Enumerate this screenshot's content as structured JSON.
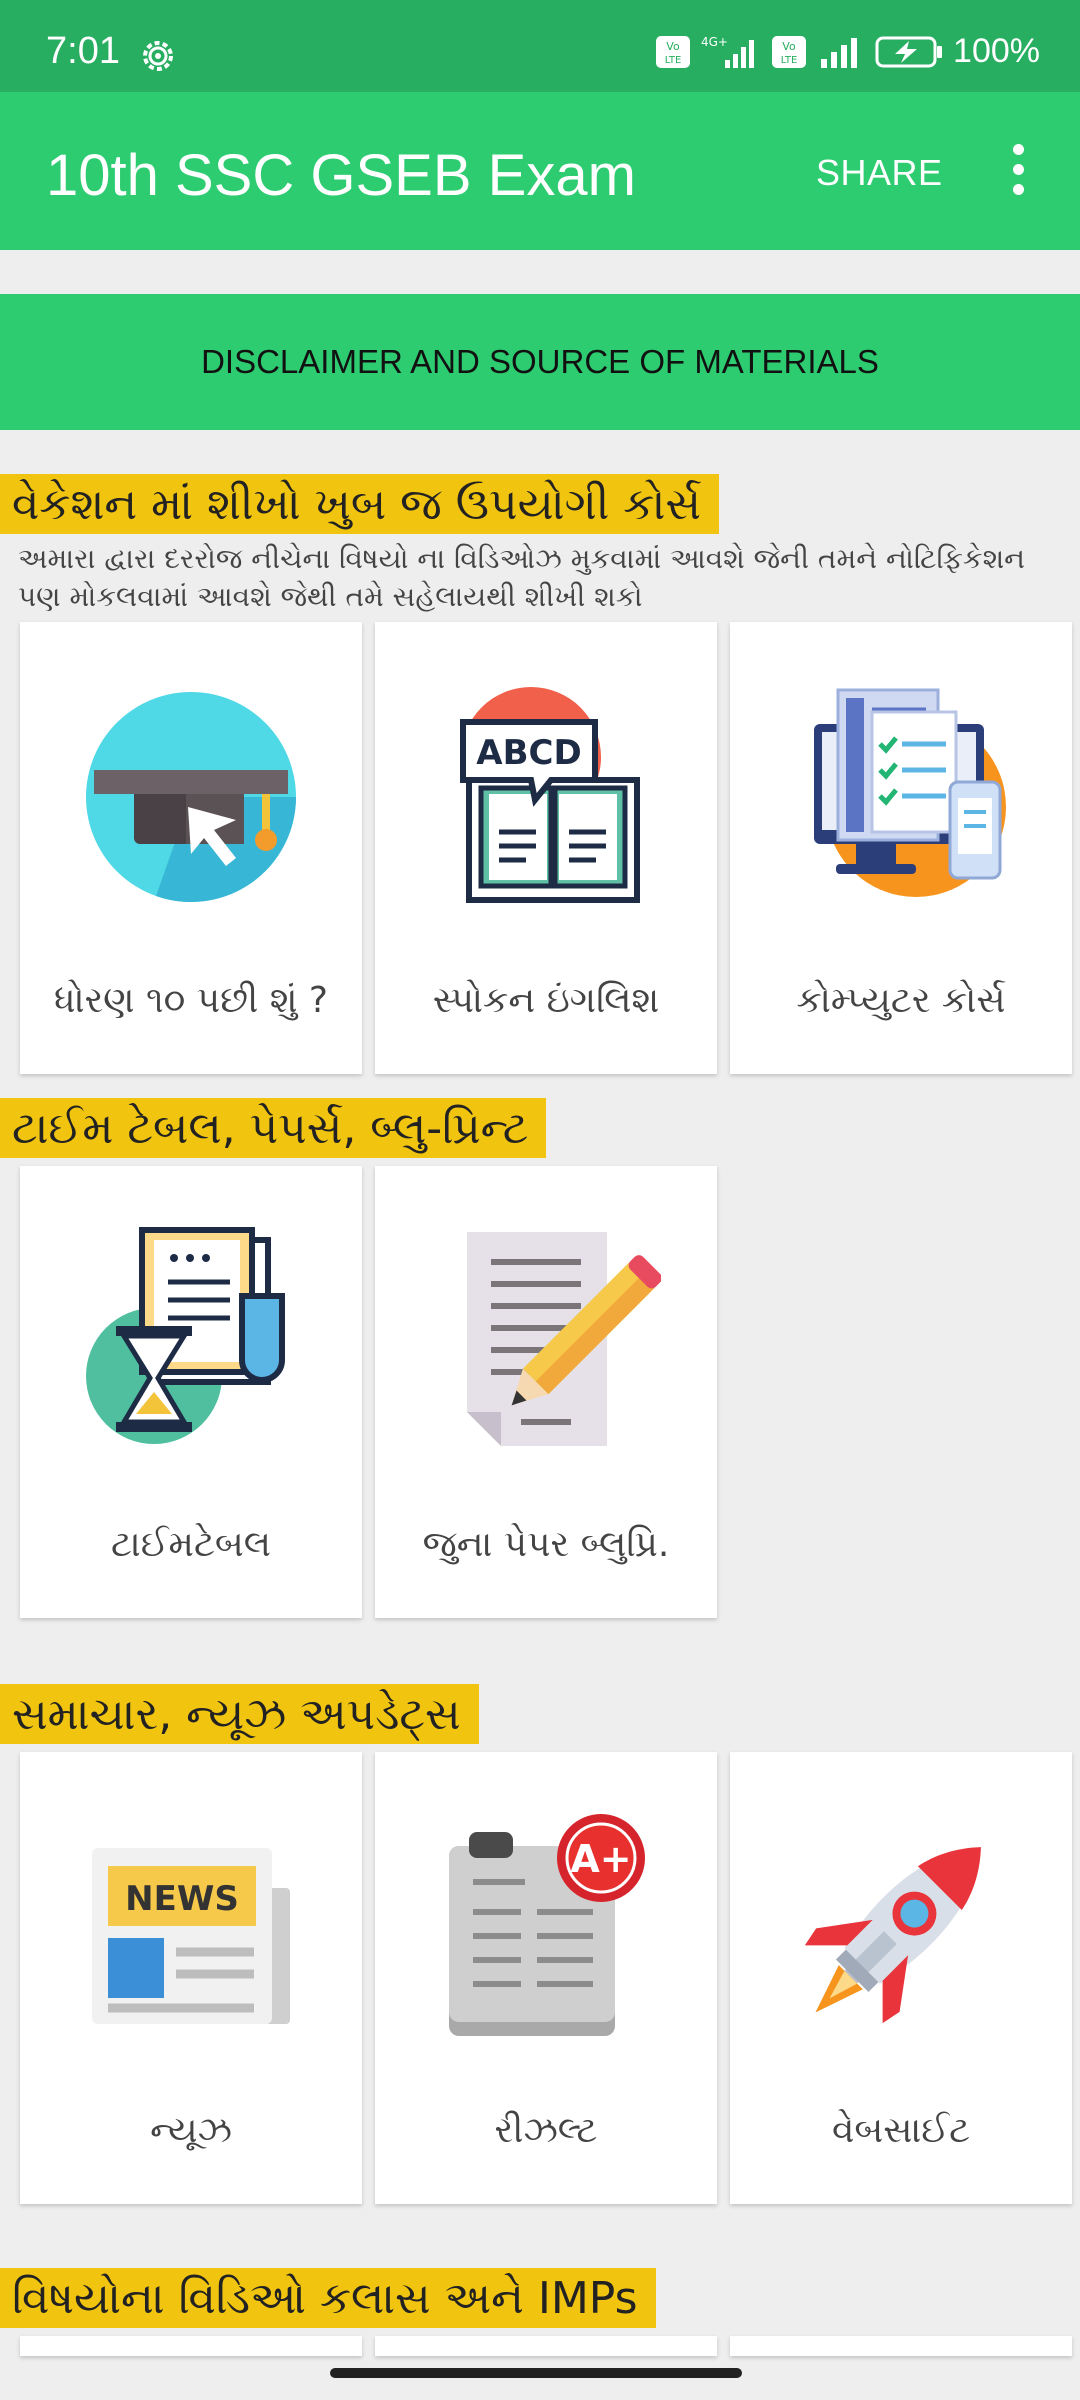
{
  "status_bar": {
    "time": "7:01",
    "battery_percent": "100%",
    "network_label": "4G+",
    "volte_label": "Vo LTE"
  },
  "app_bar": {
    "title": "10th SSC GSEB Exam",
    "share_label": "SHARE"
  },
  "disclaimer": {
    "label": "DISCLAIMER AND SOURCE OF MATERIALS"
  },
  "sections": [
    {
      "title": "વેકેશન માં શીખો ખુબ જ ઉપયોગી કોર્સ",
      "description": "અમારા દ્વારા દરરોજ નીચેના વિષયો ના વિડિઓઝ મુકવામાં આવશે જેની તમને નોટિફિકેશન પણ મોકલવામાં આવશે જેથી તમે સહેલાયથી શીખી શકો",
      "cards": [
        {
          "label": "ધોરણ ૧૦ પછી શું ?",
          "icon": "graduation-cap-icon"
        },
        {
          "label": "સ્પોકન ઇંગલિશ",
          "icon": "abcd-book-icon",
          "icon_text": "ABCD"
        },
        {
          "label": "કોમ્પ્યુટર કોર્સ",
          "icon": "computer-icon"
        }
      ]
    },
    {
      "title": "ટાઈમ ટેબલ, પેપર્સ, બ્લુ-પ્રિન્ટ",
      "cards": [
        {
          "label": "ટાઈમટેબલ",
          "icon": "hourglass-document-icon"
        },
        {
          "label": "જુના પેપર બ્લુપ્રિ.",
          "icon": "paper-pencil-icon"
        }
      ]
    },
    {
      "title": "સમાચાર, ન્યૂઝ અપડેટ્સ",
      "cards": [
        {
          "label": "ન્યૂઝ",
          "icon": "newspaper-icon",
          "icon_text": "NEWS"
        },
        {
          "label": "રીઝલ્ટ",
          "icon": "result-clipboard-icon",
          "icon_text": "A+"
        },
        {
          "label": "વેબસાઈટ",
          "icon": "rocket-icon"
        }
      ]
    },
    {
      "title": "વિષયોના વિડિઓ કલાસ અને IMPs"
    }
  ],
  "colors": {
    "status_bar": "#27ae60",
    "app_bar": "#2ecc71",
    "section_header": "#f1c40f",
    "background": "#eeeeee"
  }
}
